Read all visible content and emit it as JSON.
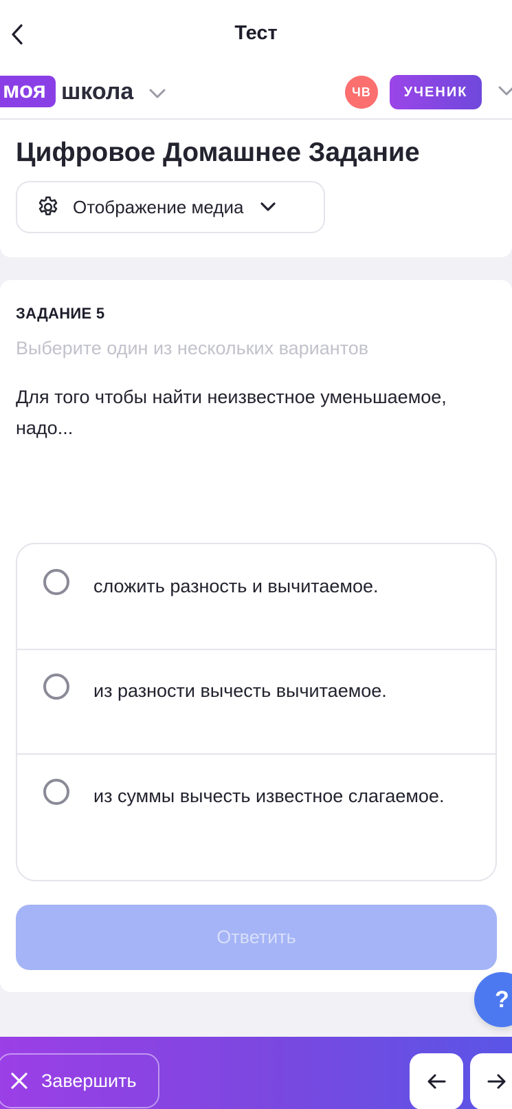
{
  "topbar": {
    "title": "Тест"
  },
  "brand": {
    "box_text": "моя",
    "text": "школа"
  },
  "user": {
    "initials": "ЧВ",
    "role": "УЧЕНИК"
  },
  "header": {
    "title": "Цифровое Домашнее Задание",
    "media_button_label": "Отображение медиа"
  },
  "task": {
    "number_label": "ЗАДАНИЕ 5",
    "hint": "Выберите один из нескольких вариантов",
    "question": "Для того чтобы найти неизвестное уменьшаемое, надо...",
    "options": [
      {
        "text": "сложить разность и вычитаемое."
      },
      {
        "text": "из разности вычесть вычитаемое."
      },
      {
        "text": "из суммы вычесть известное слагаемое."
      }
    ],
    "answer_label": "Ответить"
  },
  "help": {
    "label": "?"
  },
  "bottombar": {
    "finish_label": "Завершить"
  },
  "colors": {
    "accent_purple": "#8a3fe6",
    "avatar_red": "#fb6f6f",
    "answer_disabled": "#a4b4f6",
    "help_blue": "#4d79f0"
  }
}
